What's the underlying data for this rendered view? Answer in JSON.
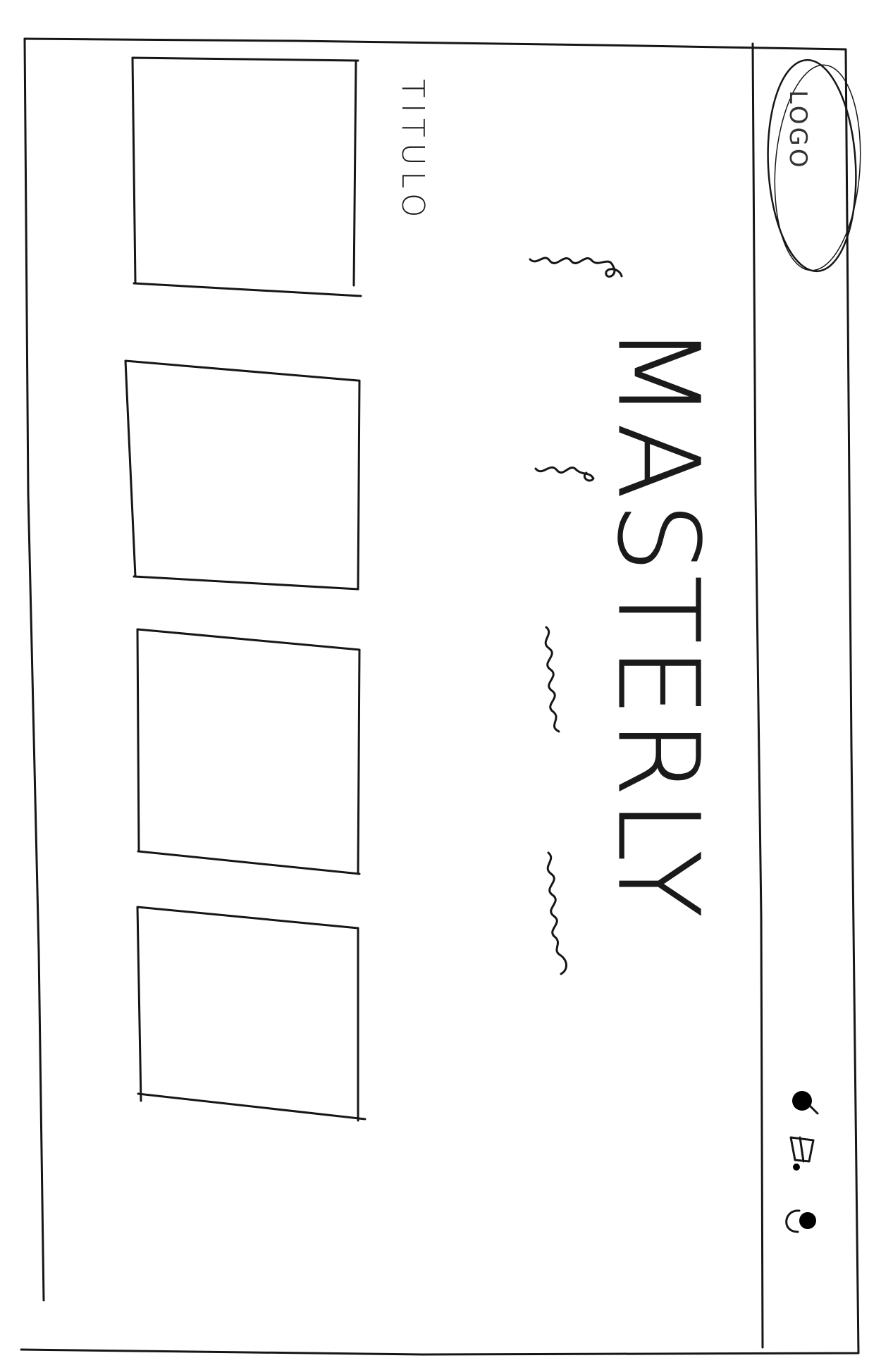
{
  "header": {
    "logo_text": "LOGO",
    "icons": [
      "search-icon",
      "cart-icon",
      "user-icon"
    ]
  },
  "hero": {
    "title": "MASTERLY",
    "subtitle_placeholder": "scribble"
  },
  "section": {
    "title": "TITULO",
    "cards": [
      {
        "name": "card-1"
      },
      {
        "name": "card-2"
      },
      {
        "name": "card-3"
      },
      {
        "name": "card-4"
      }
    ]
  }
}
